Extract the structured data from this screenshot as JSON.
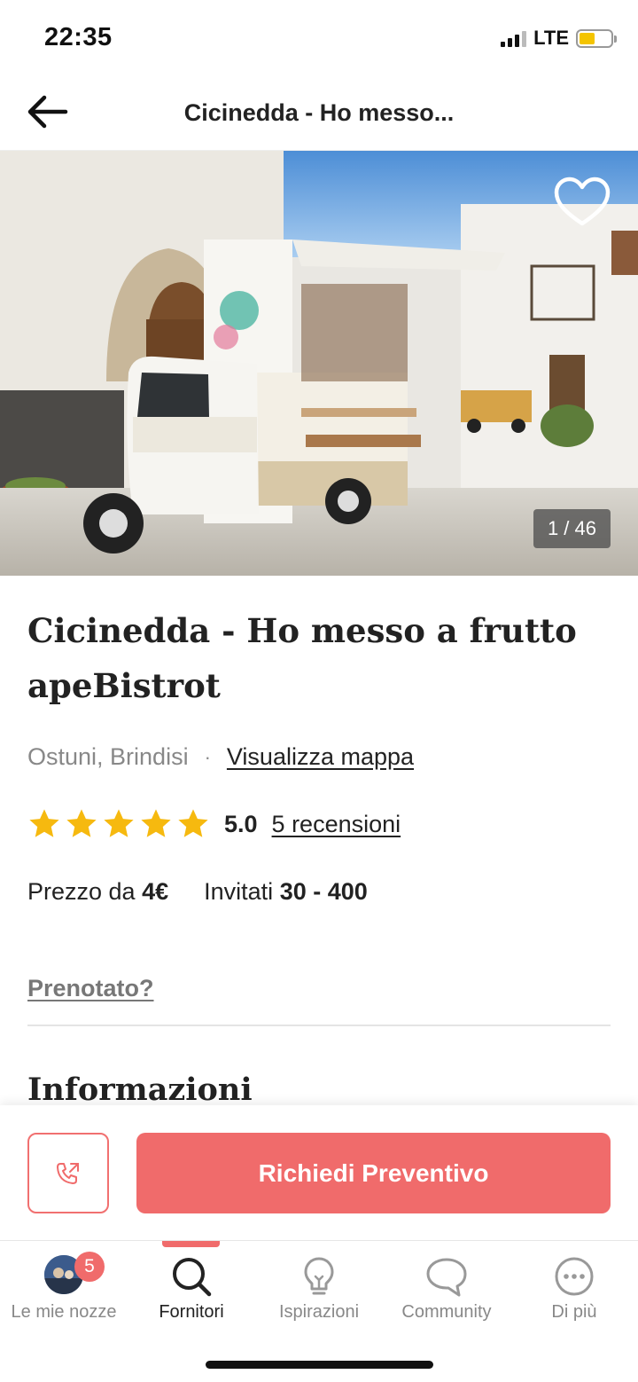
{
  "status_bar": {
    "time": "22:35",
    "network": "LTE"
  },
  "header": {
    "title": "Cicinedda - Ho messo..."
  },
  "gallery": {
    "counter": "1 / 46"
  },
  "vendor": {
    "name": "Cicinedda - Ho messo a frutto apeBistrot",
    "location": "Ostuni, Brindisi",
    "separator": "·",
    "map_link": "Visualizza mappa",
    "rating_value": "5.0",
    "stars": 5,
    "reviews_link": "5 recensioni",
    "price_label": "Prezzo da",
    "price_value": "4€",
    "guests_label": "Invitati",
    "guests_value": "30 - 400"
  },
  "booked_link": "Prenotato?",
  "section_title": "Informazioni",
  "actions": {
    "quote_button": "Richiedi Preventivo"
  },
  "tabs": [
    {
      "label": "Le mie nozze",
      "badge": "5"
    },
    {
      "label": "Fornitori"
    },
    {
      "label": "Ispirazioni"
    },
    {
      "label": "Community"
    },
    {
      "label": "Di più"
    }
  ],
  "colors": {
    "accent": "#f06b6b",
    "star": "#f6b90f"
  }
}
